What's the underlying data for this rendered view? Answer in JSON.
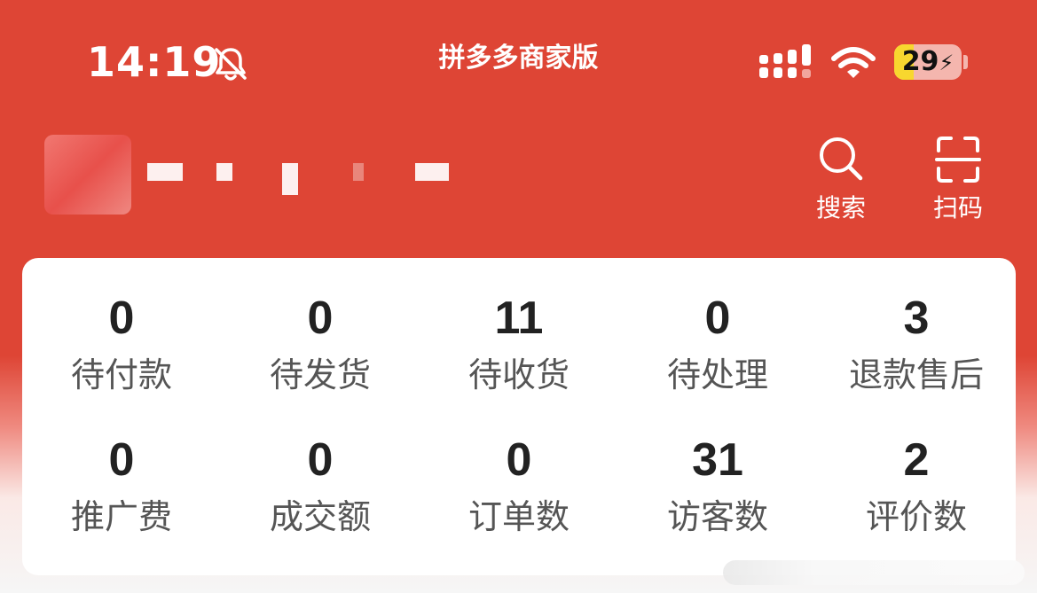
{
  "status_bar": {
    "time": "14:19",
    "bell_icon": "bell-slash-icon",
    "app_title": "拼多多商家版",
    "signal_icon": "cellular-signal-icon",
    "wifi_icon": "wifi-icon",
    "battery": {
      "level": "29",
      "charging": true,
      "level_fraction": 0.29
    }
  },
  "header": {
    "avatar_icon": "store-avatar-blurred",
    "search": {
      "icon": "search-icon",
      "label": "搜索"
    },
    "scan": {
      "icon": "scan-icon",
      "label": "扫码"
    }
  },
  "stats": [
    {
      "value": "0",
      "label": "待付款"
    },
    {
      "value": "0",
      "label": "待发货"
    },
    {
      "value": "11",
      "label": "待收货"
    },
    {
      "value": "0",
      "label": "待处理"
    },
    {
      "value": "3",
      "label": "退款售后"
    },
    {
      "value": "0",
      "label": "推广费"
    },
    {
      "value": "0",
      "label": "成交额"
    },
    {
      "value": "0",
      "label": "订单数"
    },
    {
      "value": "31",
      "label": "访客数"
    },
    {
      "value": "2",
      "label": "评价数"
    }
  ],
  "colors": {
    "brand_red": "#de4535",
    "card_bg": "#ffffff",
    "value_text": "#222222",
    "label_text": "#555555",
    "battery_fill": "#f8d72f"
  }
}
